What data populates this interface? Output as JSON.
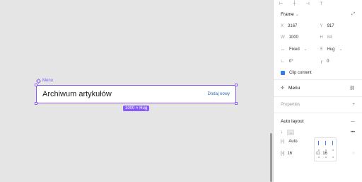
{
  "canvas": {
    "frame_name": "Menu",
    "menu_title": "Archiwum artykułów",
    "menu_action": "Dodaj nowy",
    "size_badge": "1000 × Hug"
  },
  "panel": {
    "frame": {
      "title": "Frame",
      "x_label": "X",
      "x_value": "3167",
      "y_label": "Y",
      "y_value": "917",
      "w_label": "W",
      "w_value": "1000",
      "h_label": "H",
      "h_value": "84",
      "width_mode": "Fixed",
      "height_mode": "Hug",
      "rotation": "0°",
      "corner": "0",
      "clip_label": "Clip content"
    },
    "component": {
      "label": "Menu"
    },
    "properties": {
      "title": "Properties"
    },
    "auto_layout": {
      "title": "Auto layout",
      "gap_mode": "Auto",
      "padding_h": "16",
      "padding_v": "16"
    }
  },
  "colors": {
    "selection": "#8a5cf6",
    "accent": "#2f80ed"
  }
}
